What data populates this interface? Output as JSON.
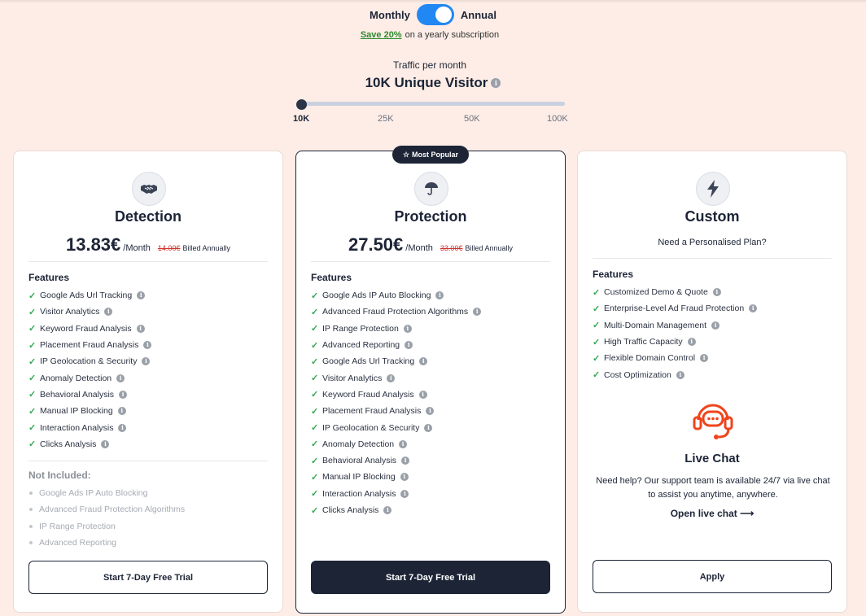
{
  "billing": {
    "monthly_label": "Monthly",
    "annual_label": "Annual",
    "annual_selected": true,
    "save_text": "Save 20%",
    "save_suffix": "on a yearly subscription"
  },
  "traffic": {
    "label": "Traffic per month",
    "value": "10K Unique Visitor",
    "ticks": [
      "10K",
      "25K",
      "50K",
      "100K"
    ],
    "selected_tick": "10K"
  },
  "info_glyph": "i",
  "colors": {
    "page_bg": "#fdede6",
    "accent": "#2188f3",
    "dark": "#1c2436",
    "check": "#34a853",
    "strike": "#d0312d",
    "chat": "#f0441c"
  },
  "plans": [
    {
      "name": "Detection",
      "icon": "handshake-icon",
      "price": "13.83€",
      "per": "/Month",
      "old_price": "14.00€",
      "billed": "Billed Annually",
      "features_title": "Features",
      "features": [
        "Google Ads Url Tracking",
        "Visitor Analytics",
        "Keyword Fraud Analysis",
        "Placement Fraud Analysis",
        "IP Geolocation & Security",
        "Anomaly Detection",
        "Behavioral Analysis",
        "Manual IP Blocking",
        "Interaction Analysis",
        "Clicks Analysis"
      ],
      "not_included_title": "Not Included:",
      "not_included": [
        "Google Ads IP Auto Blocking",
        "Advanced Fraud Protection Algorithms",
        "IP Range Protection",
        "Advanced Reporting"
      ],
      "button": "Start 7-Day Free Trial"
    },
    {
      "name": "Protection",
      "badge": "Most Popular",
      "icon": "umbrella-icon",
      "price": "27.50€",
      "per": "/Month",
      "old_price": "33.00€",
      "billed": "Billed Annually",
      "features_title": "Features",
      "features": [
        "Google Ads IP Auto Blocking",
        "Advanced Fraud Protection Algorithms",
        "IP Range Protection",
        "Advanced Reporting",
        "Google Ads Url Tracking",
        "Visitor Analytics",
        "Keyword Fraud Analysis",
        "Placement Fraud Analysis",
        "IP Geolocation & Security",
        "Anomaly Detection",
        "Behavioral Analysis",
        "Manual IP Blocking",
        "Interaction Analysis",
        "Clicks Analysis"
      ],
      "button": "Start 7-Day Free Trial"
    },
    {
      "name": "Custom",
      "icon": "lightning-icon",
      "subtitle": "Need a Personalised Plan?",
      "features_title": "Features",
      "features": [
        "Customized Demo & Quote",
        "Enterprise-Level Ad Fraud Protection",
        "Multi-Domain Management",
        "High Traffic Capacity",
        "Flexible Domain Control",
        "Cost Optimization"
      ],
      "chat_title": "Live Chat",
      "chat_desc": "Need help? Our support team is available 24/7 via live chat to assist you anytime, anywhere.",
      "chat_link": "Open live chat ⟶",
      "button": "Apply"
    }
  ]
}
